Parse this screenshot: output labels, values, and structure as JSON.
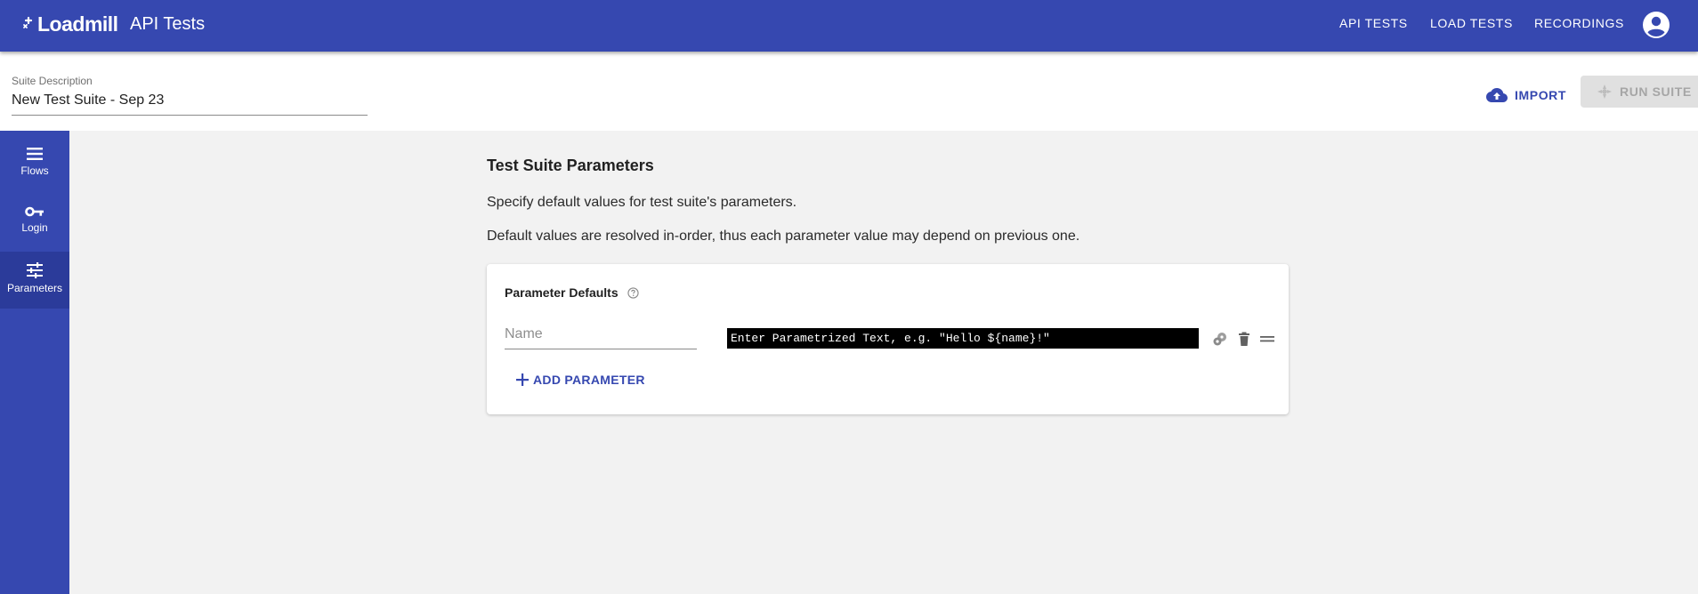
{
  "appbar": {
    "logo_text": "Loadmill",
    "title": "API Tests",
    "nav": [
      "API TESTS",
      "LOAD TESTS",
      "RECORDINGS"
    ]
  },
  "suite": {
    "description_label": "Suite Description",
    "description_value": "New Test Suite - Sep 23",
    "import_label": "IMPORT",
    "run_label": "RUN SUITE"
  },
  "sidebar": {
    "items": [
      {
        "label": "Flows",
        "icon": "list-icon"
      },
      {
        "label": "Login",
        "icon": "key-icon"
      },
      {
        "label": "Parameters",
        "icon": "tune-icon"
      }
    ],
    "active": "Parameters"
  },
  "main": {
    "title": "Test Suite Parameters",
    "description_1": "Specify default values for test suite's parameters.",
    "description_2": "Default values are resolved in-order, thus each parameter value may depend on previous one."
  },
  "card": {
    "title": "Parameter Defaults",
    "name_placeholder": "Name",
    "value_placeholder": "Enter Parametrized Text, e.g. \"Hello ${name}!\"",
    "add_label": "ADD PARAMETER"
  },
  "colors": {
    "primary": "#3648b0",
    "sidebar_active": "#2b3b9a",
    "background": "#f2f2f2"
  }
}
